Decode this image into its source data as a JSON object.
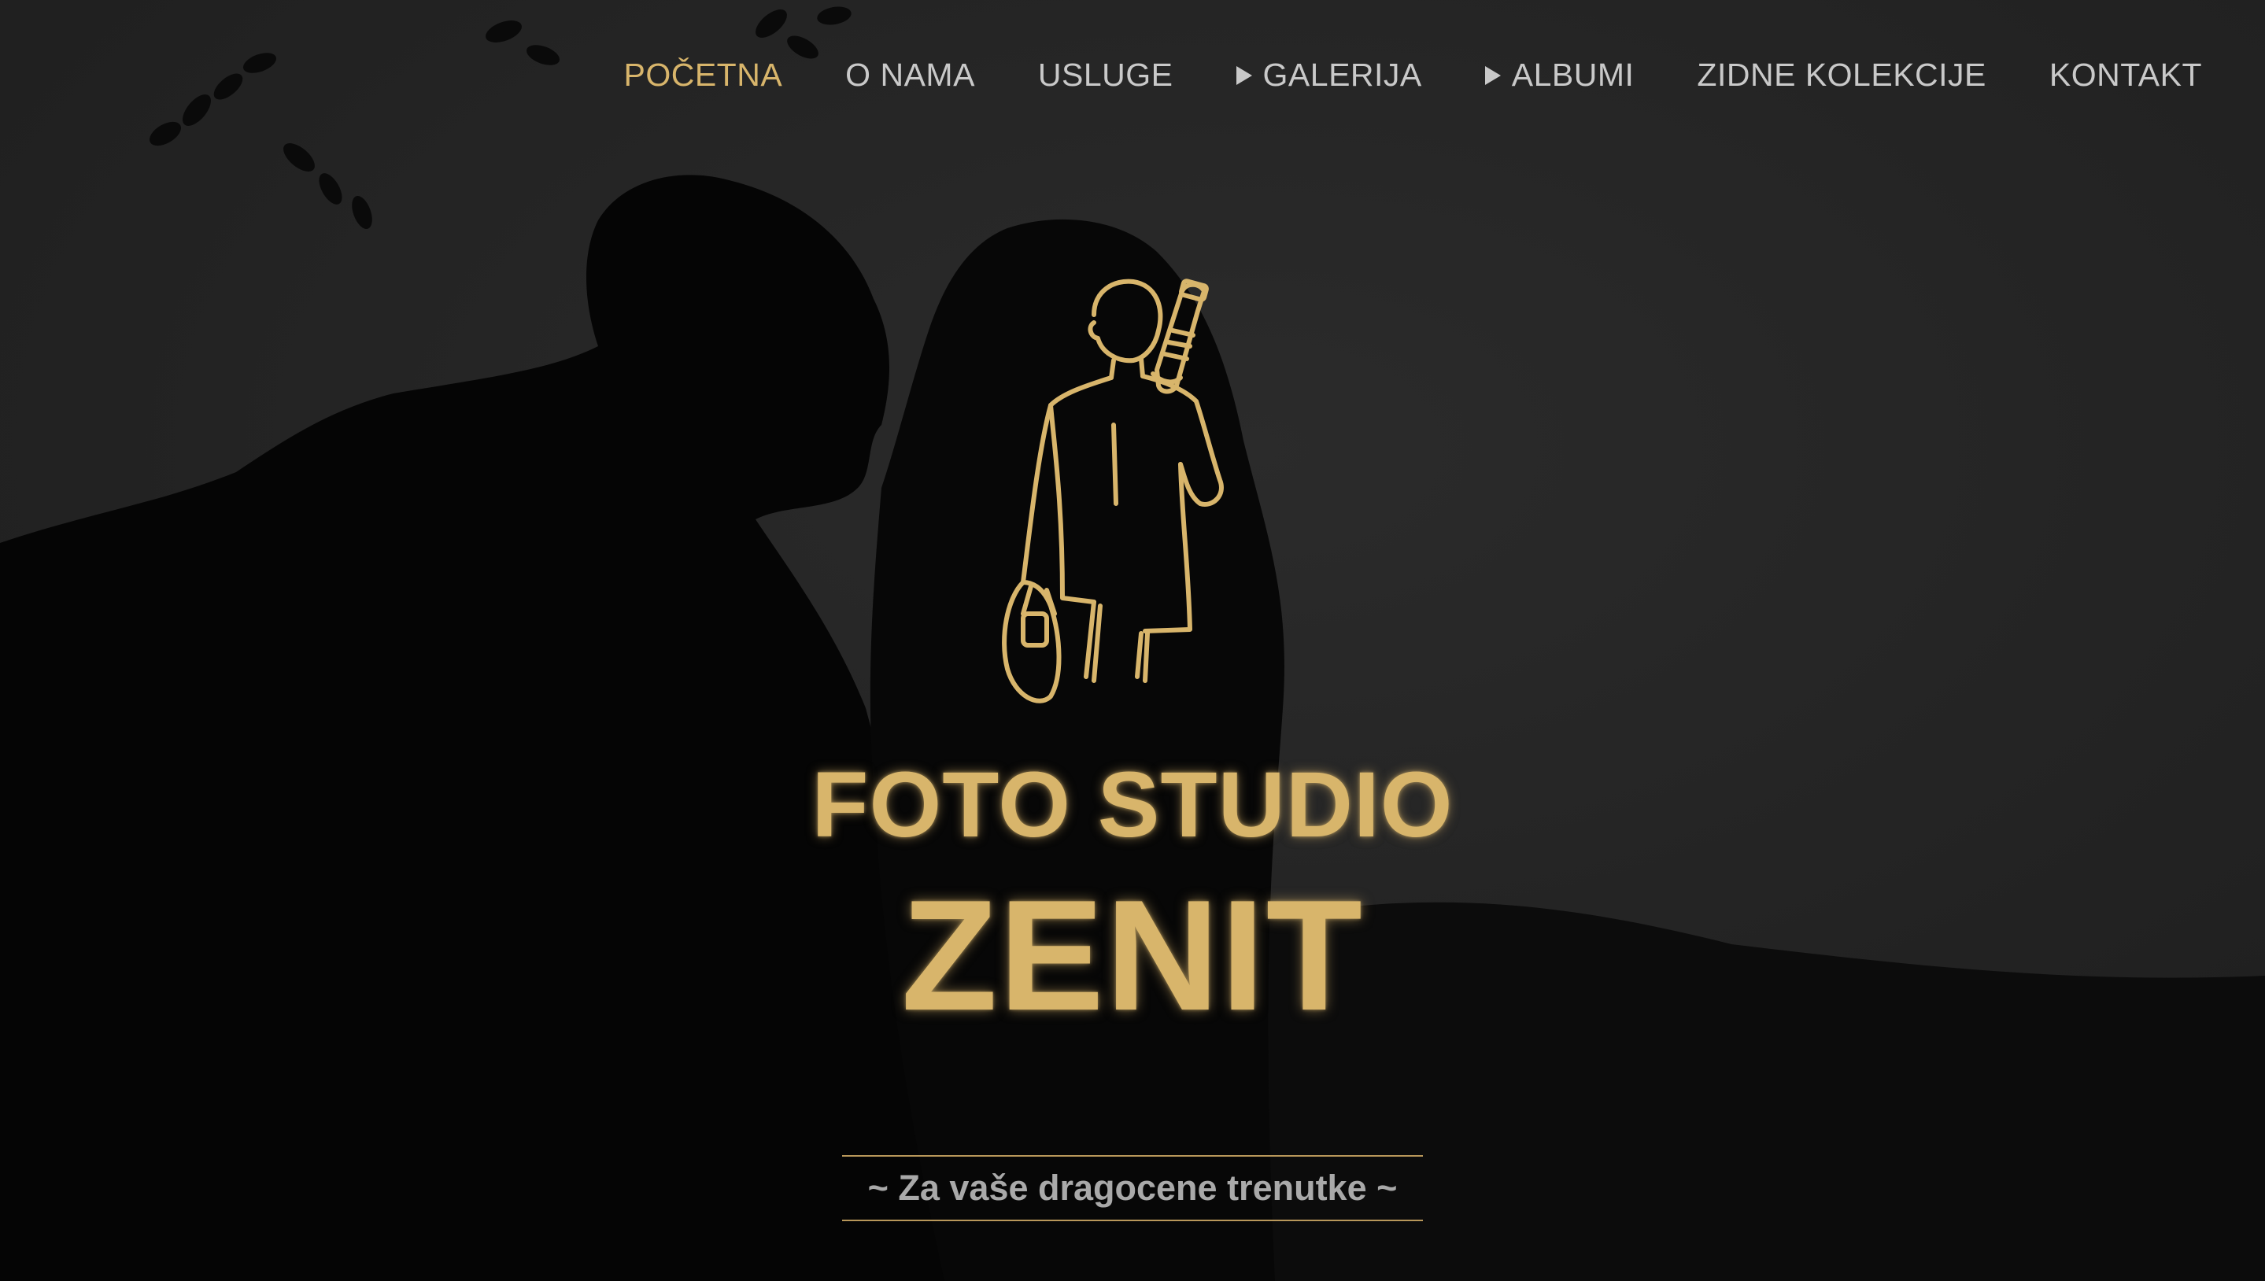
{
  "nav": {
    "items": [
      {
        "label": "POČETNA",
        "active": true,
        "has_submenu": false
      },
      {
        "label": "O NAMA",
        "active": false,
        "has_submenu": false
      },
      {
        "label": "USLUGE",
        "active": false,
        "has_submenu": false
      },
      {
        "label": "GALERIJA",
        "active": false,
        "has_submenu": true
      },
      {
        "label": "ALBUMI",
        "active": false,
        "has_submenu": true
      },
      {
        "label": "ZIDNE KOLEKCIJE",
        "active": false,
        "has_submenu": false
      },
      {
        "label": "KONTAKT",
        "active": false,
        "has_submenu": false
      }
    ]
  },
  "hero": {
    "logo_icon": "photographer-with-camera-line-art-icon",
    "brand_line1": "FOTO STUDIO",
    "brand_line2": "ZENIT",
    "tagline": "~ Za vaše dragocene trenutke ~"
  },
  "colors": {
    "accent_gold": "#d8b56b",
    "nav_text": "#c9c9c9",
    "tagline_text": "#a9a9a9",
    "background": "#1e1e1e"
  }
}
